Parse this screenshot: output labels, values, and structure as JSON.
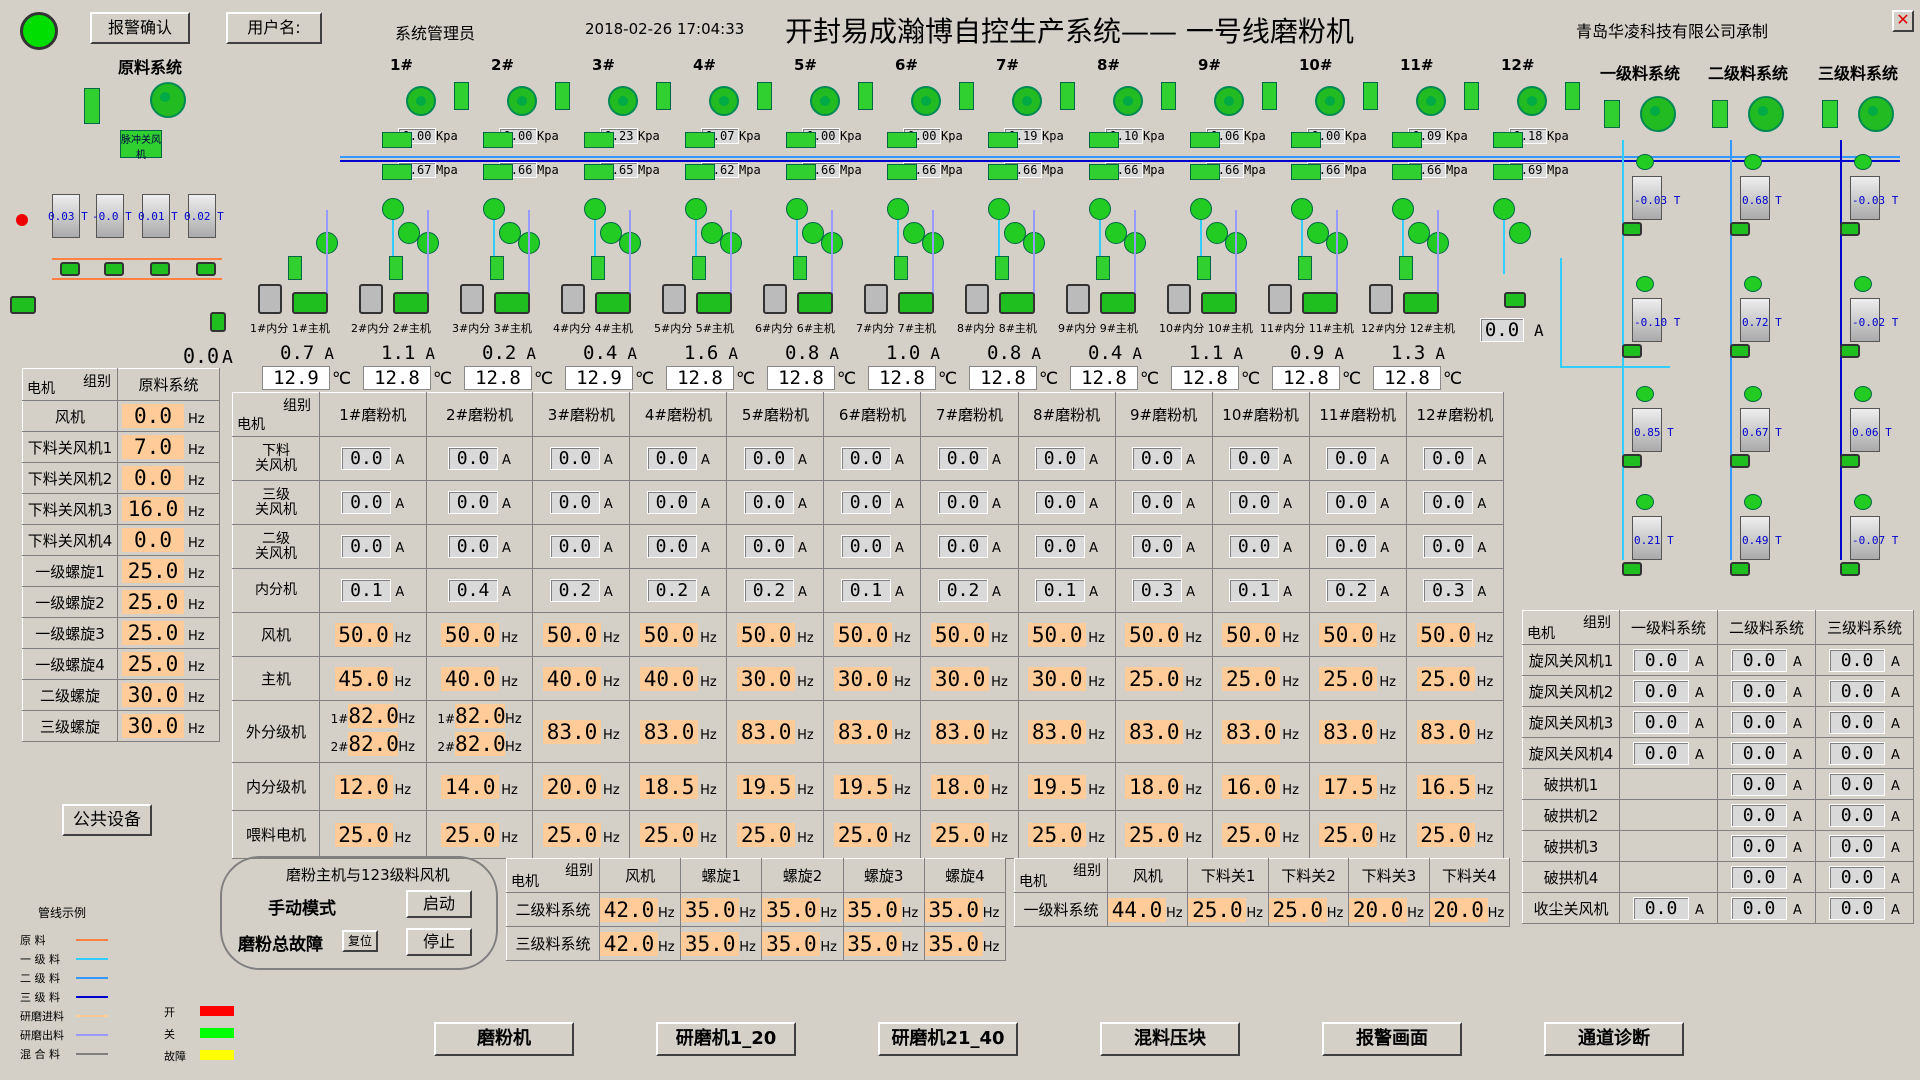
{
  "header": {
    "alarm_ack": "报警确认",
    "user_label": "用户名:",
    "user_name": "系统管理员",
    "datetime": "2018-02-26 17:04:33",
    "title": "开封易成瀚博自控生产系统——  一号线磨粉机",
    "company": "青岛华凌科技有限公司承制"
  },
  "colors": {
    "on": "#00ff00",
    "off": "#ff0000",
    "fault": "#ffff00",
    "accent_hz": "#ffcc99",
    "bg": "#d4d0c8"
  },
  "raw_system": {
    "title": "原料系统",
    "tanks": [
      "0.03",
      "-0.0",
      "0.01",
      "0.02"
    ],
    "tank_unit": "T",
    "tag": "脉冲关风机"
  },
  "mills_top": {
    "labels": [
      "1#",
      "2#",
      "3#",
      "4#",
      "5#",
      "6#",
      "7#",
      "8#",
      "9#",
      "10#",
      "11#",
      "12#"
    ],
    "kpa": [
      "0.00",
      "0.00",
      "0.23",
      "0.07",
      "0.00",
      "0.00",
      "0.19",
      "0.10",
      "0.06",
      "0.00",
      "0.09",
      "0.18"
    ],
    "kpa_unit": "Kpa",
    "mpa": [
      "0.67",
      "0.66",
      "0.65",
      "0.62",
      "0.66",
      "0.66",
      "0.66",
      "0.66",
      "0.66",
      "0.66",
      "0.66",
      "0.69"
    ],
    "mpa_unit": "Mpa",
    "machine_labels": [
      "1#内分",
      "1#主机",
      "2#内分",
      "2#主机",
      "3#内分",
      "3#主机",
      "4#内分",
      "4#主机",
      "5#内分",
      "5#主机",
      "6#内分",
      "6#主机",
      "7#内分",
      "7#主机",
      "8#内分",
      "8#主机",
      "9#内分",
      "9#主机",
      "10#内分",
      "10#主机",
      "11#内分",
      "11#主机",
      "12#内分",
      "12#主机"
    ],
    "amps": [
      "0.0",
      "0.7",
      "1.1",
      "0.2",
      "0.4",
      "1.6",
      "0.8",
      "1.0",
      "0.8",
      "0.4",
      "1.1",
      "0.9",
      "1.3",
      "0.0"
    ],
    "amp_unit": "A",
    "temps": [
      "12.9",
      "12.8",
      "12.8",
      "12.9",
      "12.8",
      "12.8",
      "12.8",
      "12.8",
      "12.8",
      "12.8",
      "12.8",
      "12.8"
    ],
    "temp_unit": "℃"
  },
  "raw_table": {
    "header_group": "组别",
    "header_motor": "电机",
    "header_col": "原料系统",
    "rows": [
      {
        "name": "风机",
        "value": "0.0",
        "unit": "Hz"
      },
      {
        "name": "下料关风机1",
        "value": "7.0",
        "unit": "Hz"
      },
      {
        "name": "下料关风机2",
        "value": "0.0",
        "unit": "Hz"
      },
      {
        "name": "下料关风机3",
        "value": "16.0",
        "unit": "Hz"
      },
      {
        "name": "下料关风机4",
        "value": "0.0",
        "unit": "Hz"
      },
      {
        "name": "一级螺旋1",
        "value": "25.0",
        "unit": "Hz"
      },
      {
        "name": "一级螺旋2",
        "value": "25.0",
        "unit": "Hz"
      },
      {
        "name": "一级螺旋3",
        "value": "25.0",
        "unit": "Hz"
      },
      {
        "name": "一级螺旋4",
        "value": "25.0",
        "unit": "Hz"
      },
      {
        "name": "二级螺旋",
        "value": "30.0",
        "unit": "Hz"
      },
      {
        "name": "三级螺旋",
        "value": "30.0",
        "unit": "Hz"
      }
    ]
  },
  "mill_table": {
    "header_group": "组别",
    "header_motor": "电机",
    "columns": [
      "1#磨粉机",
      "2#磨粉机",
      "3#磨粉机",
      "4#磨粉机",
      "5#磨粉机",
      "6#磨粉机",
      "7#磨粉机",
      "8#磨粉机",
      "9#磨粉机",
      "10#磨粉机",
      "11#磨粉机",
      "12#磨粉机"
    ],
    "rows_a": [
      {
        "name": "下料关风机",
        "values": [
          "0.0",
          "0.0",
          "0.0",
          "0.0",
          "0.0",
          "0.0",
          "0.0",
          "0.0",
          "0.0",
          "0.0",
          "0.0",
          "0.0"
        ],
        "unit": "A"
      },
      {
        "name": "三级关风机",
        "values": [
          "0.0",
          "0.0",
          "0.0",
          "0.0",
          "0.0",
          "0.0",
          "0.0",
          "0.0",
          "0.0",
          "0.0",
          "0.0",
          "0.0"
        ],
        "unit": "A"
      },
      {
        "name": "二级关风机",
        "values": [
          "0.0",
          "0.0",
          "0.0",
          "0.0",
          "0.0",
          "0.0",
          "0.0",
          "0.0",
          "0.0",
          "0.0",
          "0.0",
          "0.0"
        ],
        "unit": "A"
      },
      {
        "name": "内分机",
        "values": [
          "0.1",
          "0.4",
          "0.2",
          "0.2",
          "0.2",
          "0.1",
          "0.2",
          "0.1",
          "0.3",
          "0.1",
          "0.2",
          "0.3"
        ],
        "unit": "A"
      }
    ],
    "rows_hz": [
      {
        "name": "风机",
        "values": [
          "50.0",
          "50.0",
          "50.0",
          "50.0",
          "50.0",
          "50.0",
          "50.0",
          "50.0",
          "50.0",
          "50.0",
          "50.0",
          "50.0"
        ],
        "unit": "Hz"
      },
      {
        "name": "主机",
        "values": [
          "45.0",
          "40.0",
          "40.0",
          "40.0",
          "30.0",
          "30.0",
          "30.0",
          "30.0",
          "25.0",
          "25.0",
          "25.0",
          "25.0"
        ],
        "unit": "Hz"
      }
    ],
    "outer_row": {
      "name": "外分级机",
      "dual": [
        [
          "82.0",
          "82.0"
        ],
        [
          "82.0",
          "82.0"
        ]
      ],
      "dual_labels": [
        "1#",
        "2#"
      ],
      "values": [
        "83.0",
        "83.0",
        "83.0",
        "83.0",
        "83.0",
        "83.0",
        "83.0",
        "83.0",
        "83.0",
        "83.0"
      ],
      "unit": "Hz"
    },
    "rows_hz2": [
      {
        "name": "内分级机",
        "values": [
          "12.0",
          "14.0",
          "20.0",
          "18.5",
          "19.5",
          "19.5",
          "18.0",
          "19.5",
          "18.0",
          "16.0",
          "17.5",
          "16.5"
        ],
        "unit": "Hz"
      },
      {
        "name": "喂料电机",
        "values": [
          "25.0",
          "25.0",
          "25.0",
          "25.0",
          "25.0",
          "25.0",
          "25.0",
          "25.0",
          "25.0",
          "25.0",
          "25.0",
          "25.0"
        ],
        "unit": "Hz"
      }
    ]
  },
  "right_system": {
    "titles": [
      "一级料系统",
      "二级料系统",
      "三级料系统"
    ],
    "silos": [
      [
        "-0.03",
        "0.68",
        "-0.03"
      ],
      [
        "-0.10",
        "0.72",
        "-0.02"
      ],
      [
        "0.85",
        "0.67",
        "0.06"
      ],
      [
        "0.21",
        "0.49",
        "-0.07"
      ]
    ],
    "silo_unit": "T"
  },
  "right_table": {
    "header_group": "组别",
    "header_motor": "电机",
    "columns": [
      "一级料系统",
      "二级料系统",
      "三级料系统"
    ],
    "rows": [
      {
        "name": "旋风关风机1",
        "values": [
          "0.0",
          "0.0",
          "0.0"
        ]
      },
      {
        "name": "旋风关风机2",
        "values": [
          "0.0",
          "0.0",
          "0.0"
        ]
      },
      {
        "name": "旋风关风机3",
        "values": [
          "0.0",
          "0.0",
          "0.0"
        ]
      },
      {
        "name": "旋风关风机4",
        "values": [
          "0.0",
          "0.0",
          "0.0"
        ]
      },
      {
        "name": "破拱机1",
        "values": [
          "",
          "0.0",
          "0.0"
        ]
      },
      {
        "name": "破拱机2",
        "values": [
          "",
          "0.0",
          "0.0"
        ]
      },
      {
        "name": "破拱机3",
        "values": [
          "",
          "0.0",
          "0.0"
        ]
      },
      {
        "name": "破拱机4",
        "values": [
          "",
          "0.0",
          "0.0"
        ]
      },
      {
        "name": "收尘关风机",
        "values": [
          "0.0",
          "0.0",
          "0.0"
        ]
      }
    ],
    "unit": "A"
  },
  "control": {
    "title": "磨粉主机与123级料风机",
    "mode": "手动模式",
    "fault": "磨粉总故障",
    "reset": "复位",
    "start": "启动",
    "stop": "停止"
  },
  "level23_table": {
    "header_group": "组别",
    "header_motor": "电机",
    "columns": [
      "风机",
      "螺旋1",
      "螺旋2",
      "螺旋3",
      "螺旋4"
    ],
    "rows": [
      {
        "name": "二级料系统",
        "values": [
          "42.0",
          "35.0",
          "35.0",
          "35.0",
          "35.0"
        ]
      },
      {
        "name": "三级料系统",
        "values": [
          "42.0",
          "35.0",
          "35.0",
          "35.0",
          "35.0"
        ]
      }
    ],
    "unit": "Hz"
  },
  "level1_table": {
    "header_group": "组别",
    "header_motor": "电机",
    "columns": [
      "风机",
      "下料关1",
      "下料关2",
      "下料关3",
      "下料关4"
    ],
    "rows": [
      {
        "name": "一级料系统",
        "values": [
          "44.0",
          "25.0",
          "25.0",
          "20.0",
          "20.0"
        ]
      }
    ],
    "unit": "Hz"
  },
  "public_btn": "公共设备",
  "legend": {
    "title": "管线示例",
    "items": [
      {
        "label": "原    料",
        "color": "#ff8040"
      },
      {
        "label": "一 级 料",
        "color": "#33ccff"
      },
      {
        "label": "二 级 料",
        "color": "#3399ff"
      },
      {
        "label": "三 级 料",
        "color": "#0000cc"
      },
      {
        "label": "研磨进料",
        "color": "#ffcc99"
      },
      {
        "label": "研磨出料",
        "color": "#9999ff"
      },
      {
        "label": "混 合 料",
        "color": "#808080"
      }
    ],
    "status": [
      {
        "label": "开",
        "color": "#ff0000"
      },
      {
        "label": "关",
        "color": "#00ff00"
      },
      {
        "label": "故障",
        "color": "#ffff00"
      }
    ]
  },
  "nav": [
    "磨粉机",
    "研磨机1_20",
    "研磨机21_40",
    "混料压块",
    "报警画面",
    "通道诊断"
  ]
}
